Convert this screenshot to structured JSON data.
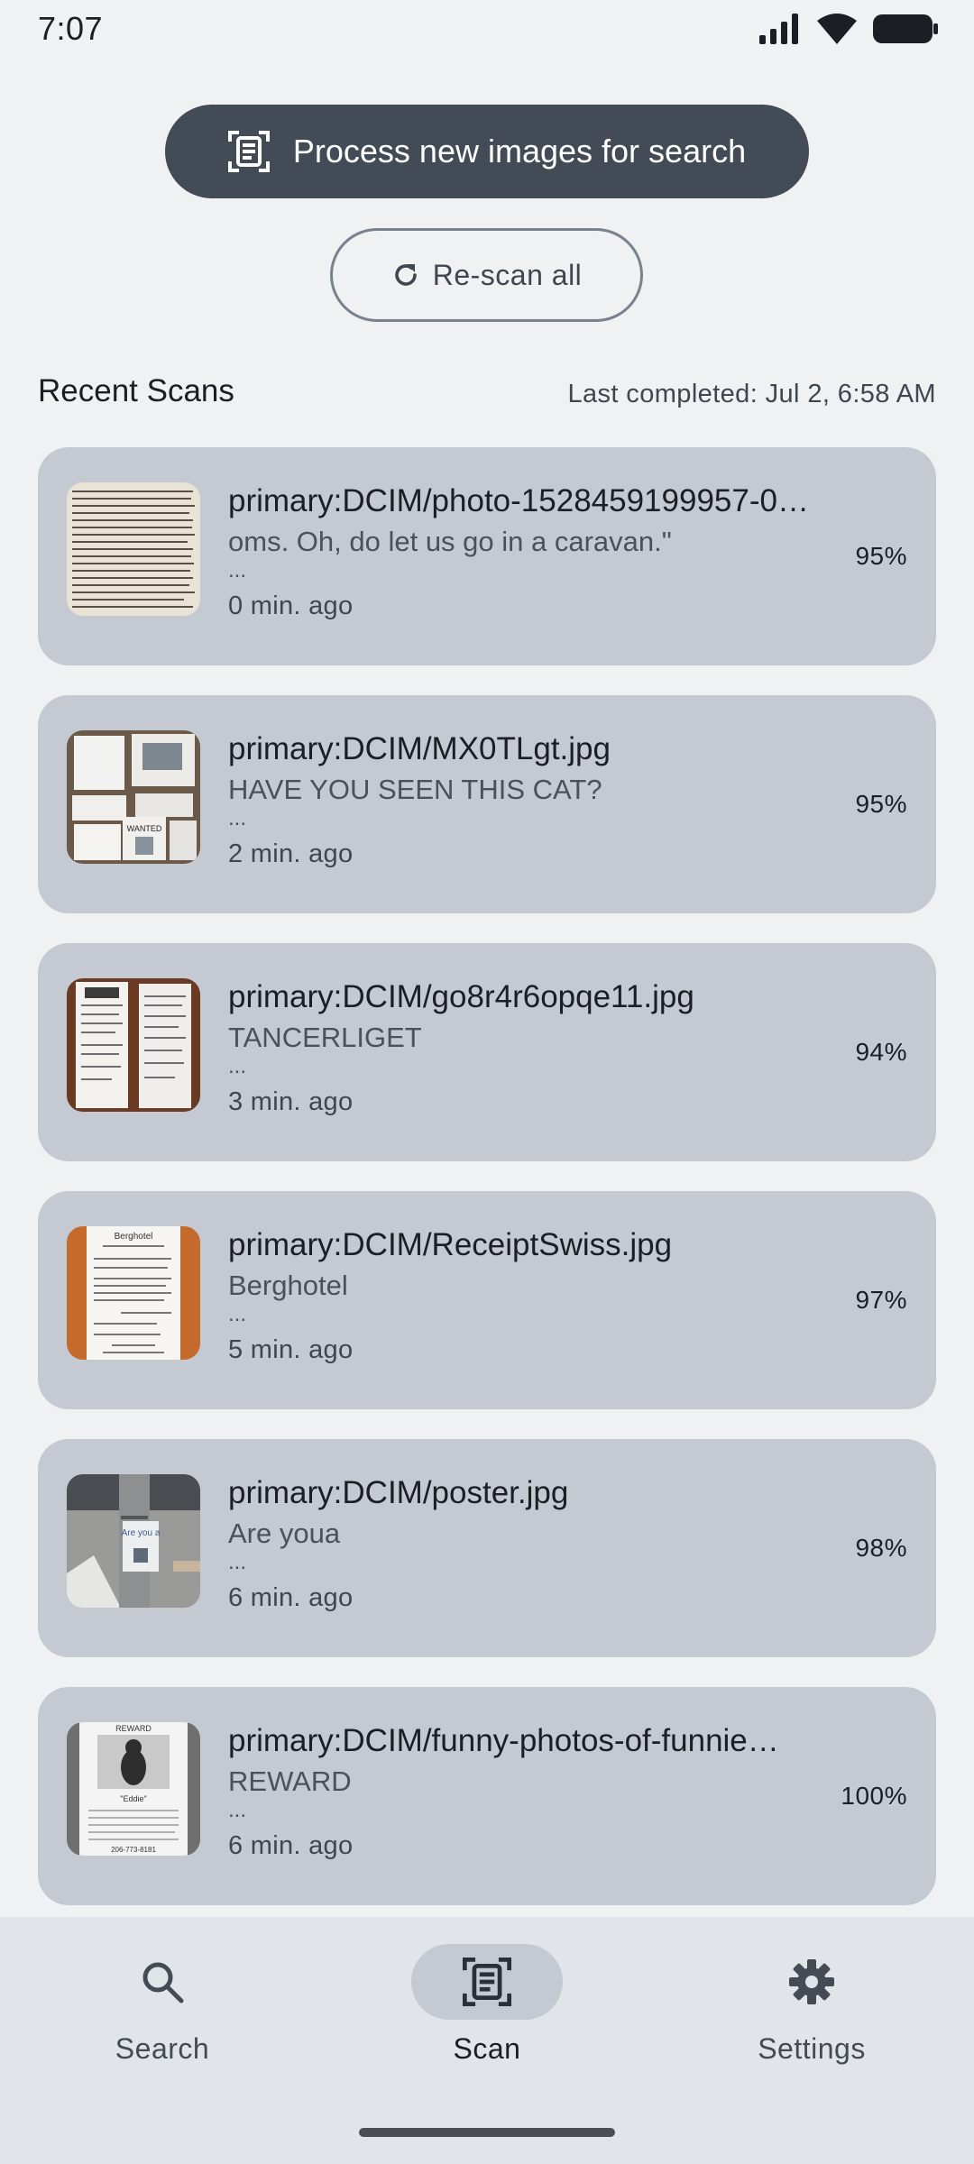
{
  "status_bar": {
    "time": "7:07"
  },
  "actions": {
    "process_label": "Process new images for search",
    "rescan_label": "Re-scan all"
  },
  "recent": {
    "title": "Recent Scans",
    "last_completed": "Last completed: Jul 2, 6:58 AM",
    "items": [
      {
        "file": "primary:DCIM/photo-1528459199957-0…",
        "excerpt": "oms. Oh, do let us go in a caravan.\"",
        "more": "...",
        "ago": "0 min. ago",
        "confidence": "95%"
      },
      {
        "file": "primary:DCIM/MX0TLgt.jpg",
        "excerpt": "HAVE YOU SEEN THIS CAT?",
        "more": "...",
        "ago": "2 min. ago",
        "confidence": "95%"
      },
      {
        "file": "primary:DCIM/go8r4r6opqe11.jpg",
        "excerpt": "TANCERLIGET",
        "more": "...",
        "ago": "3 min. ago",
        "confidence": "94%"
      },
      {
        "file": "primary:DCIM/ReceiptSwiss.jpg",
        "excerpt": "Berghotel",
        "more": "...",
        "ago": "5 min. ago",
        "confidence": "97%"
      },
      {
        "file": "primary:DCIM/poster.jpg",
        "excerpt": "Are youa",
        "more": "...",
        "ago": "6 min. ago",
        "confidence": "98%"
      },
      {
        "file": "primary:DCIM/funny-photos-of-funnie…",
        "excerpt": "REWARD",
        "more": "...",
        "ago": "6 min. ago",
        "confidence": "100%"
      }
    ]
  },
  "nav": {
    "search": "Search",
    "scan": "Scan",
    "settings": "Settings",
    "active": "scan"
  },
  "thumb_text": {
    "wanted": "WANTED",
    "are_you": "Are you a",
    "reward": "REWARD",
    "eddie": "\"Eddie\"",
    "phone": "206-773-8181",
    "berghotel": "Berghotel"
  }
}
